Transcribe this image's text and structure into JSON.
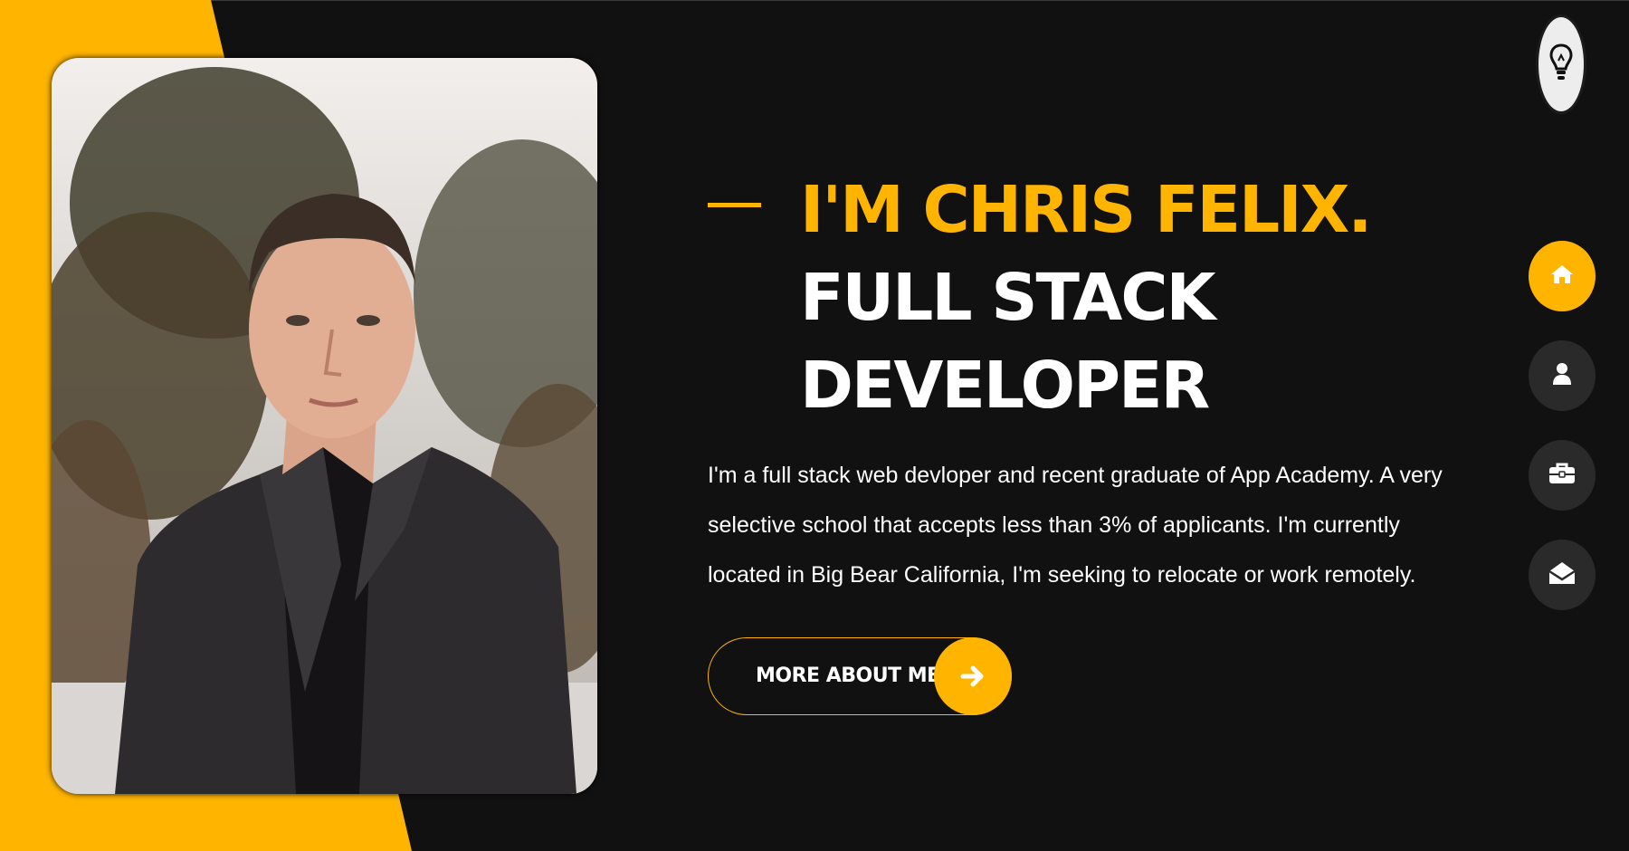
{
  "hero": {
    "name_line": "I'M CHRIS FELIX.",
    "role_line": "FULL STACK DEVELOPER",
    "bio": "I'm a full stack web devloper and recent graduate of App Academy. A very selective school that accepts less than 3% of applicants. I'm currently located in Big Bear California, I'm seeking to relocate or work remotely.",
    "cta_label": "MORE ABOUT ME",
    "cta_icon": "arrow-right-icon"
  },
  "photo": {
    "subject": "portrait-photo"
  },
  "theme_toggle": {
    "icon": "lightbulb-icon"
  },
  "nav": {
    "items": [
      {
        "id": "home",
        "icon": "home-icon",
        "active": true
      },
      {
        "id": "about",
        "icon": "user-icon",
        "active": false
      },
      {
        "id": "portfolio",
        "icon": "briefcase-icon",
        "active": false
      },
      {
        "id": "contact",
        "icon": "envelope-open-icon",
        "active": false
      }
    ]
  },
  "colors": {
    "accent": "#ffb400",
    "background": "#111111",
    "nav_inactive": "#2b2a2a",
    "text": "#ffffff"
  }
}
